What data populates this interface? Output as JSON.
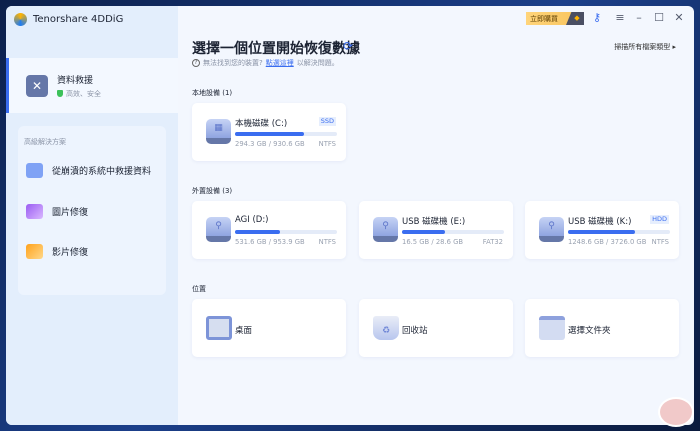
{
  "app": {
    "title": "Tenorshare 4DDiG"
  },
  "sidebar": {
    "rescue": {
      "title": "資料救援",
      "subtitle": "高效、安全"
    },
    "advanced_title": "高級解決方案",
    "items": [
      {
        "label": "從崩潰的系統中救援資料",
        "icon": "pc-restore-icon"
      },
      {
        "label": "圖片修復",
        "icon": "photo-icon"
      },
      {
        "label": "影片修復",
        "icon": "video-icon"
      }
    ]
  },
  "toolbar": {
    "buy_label": "立即購買"
  },
  "main": {
    "title": "選擇一個位置開始恢復數據",
    "scan_all": "掃描所有檔案類型 ▸",
    "help_prefix": "無法找到您的裝置?",
    "help_link": "點選這裡",
    "help_suffix": "以解決問題。",
    "local_label": "本地設備 (1)",
    "external_label": "外置設備 (3)",
    "location_label": "位置",
    "local": [
      {
        "name": "本機磁碟 (C:)",
        "badge": "SSD",
        "size": "294.3 GB / 930.6 GB",
        "fs": "NTFS",
        "used": 0.68
      }
    ],
    "external": [
      {
        "name": "AGI (D:)",
        "badge": "",
        "size": "531.6 GB / 953.9 GB",
        "fs": "NTFS",
        "used": 0.44
      },
      {
        "name": "USB 磁碟機 (E:)",
        "badge": "",
        "size": "16.5 GB / 28.6 GB",
        "fs": "FAT32",
        "used": 0.42
      },
      {
        "name": "USB 磁碟機 (K:)",
        "badge": "HDD",
        "size": "1248.6 GB / 3726.0 GB",
        "fs": "NTFS",
        "used": 0.66
      }
    ],
    "locations": [
      {
        "label": "桌面"
      },
      {
        "label": "回收站"
      },
      {
        "label": "選擇文件夾"
      }
    ]
  },
  "colors": {
    "accent": "#3a6df0",
    "sidebar": "#e3eefc",
    "background": "#f3f7fe"
  }
}
